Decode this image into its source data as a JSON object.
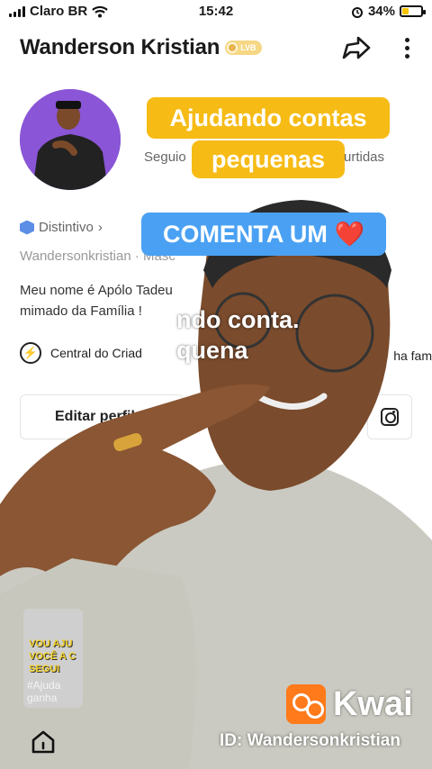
{
  "status_bar": {
    "carrier": "Claro BR",
    "time": "15:42",
    "battery": "34%",
    "battery_level": 0.34
  },
  "profile": {
    "username": "Wanderson Kristian",
    "badge_label": "LVB",
    "stats_left": "Seguio",
    "stats_right": "urtidas",
    "badge_text": "Distintivo",
    "subline": "Wandersonkristian  ·  Masc",
    "bio_line1": "Meu nome é Apólo Tadeu",
    "bio_line2": "mimado da Família !",
    "creator_center": "Central do Criad",
    "family_text": "ha fam",
    "edit_button": "Editar perfil"
  },
  "overlay": {
    "caption1": "Ajudando contas",
    "caption2": "pequenas",
    "caption3": "COMENTA UM",
    "caption3_emoji": "❤️",
    "white_line1": "ndo conta.",
    "white_line2": "quena",
    "thumb_text": "VOU AJU\nVOCÊ A C\nSEGUI",
    "thumb_tag": "#Ajuda\nganha"
  },
  "watermark": {
    "brand": "Kwai",
    "id_text": "ID: Wandersonkristian"
  },
  "icons": [
    "signal-icon",
    "wifi-icon",
    "alarm-icon",
    "battery-icon",
    "share-icon",
    "more-icon",
    "badge-hex-icon",
    "bolt-icon",
    "instagram-icon",
    "home-icon",
    "kwai-logo-icon"
  ],
  "colors": {
    "caption_yellow": "#f6bb15",
    "caption_blue": "#4aa1f3",
    "kwai_orange": "#ff7a1a",
    "avatar_purple": "#8a55d6"
  }
}
